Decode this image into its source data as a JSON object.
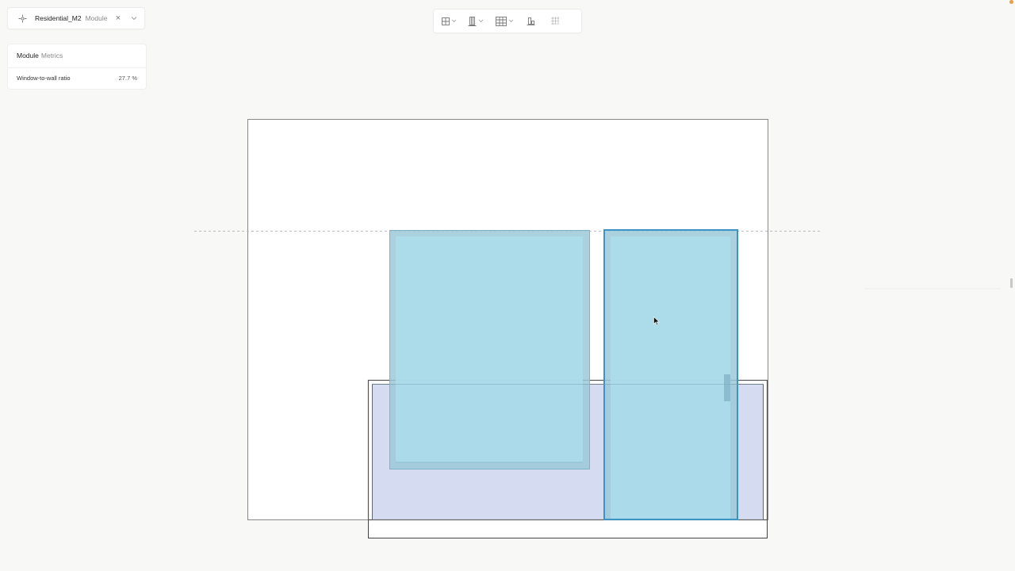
{
  "module_selector": {
    "name": "Residential_M2",
    "type": "Module",
    "icons": {
      "grip": "move-icon",
      "close": "close-icon",
      "expand": "chevron-down-icon"
    }
  },
  "metrics": {
    "title": "Module",
    "subtitle": "Metrics",
    "rows": [
      {
        "label": "Window-to-wall ratio",
        "value": "27.7 %"
      }
    ]
  },
  "toolbar": {
    "tools": [
      {
        "icon": "grid-window-icon",
        "dropdown": true
      },
      {
        "icon": "door-icon",
        "dropdown": true
      },
      {
        "icon": "facade-grid-icon",
        "dropdown": true
      },
      {
        "icon": "align-left-icon",
        "dropdown": false
      },
      {
        "icon": "dot-grid-icon",
        "dropdown": false
      }
    ]
  },
  "colors": {
    "window_fill": "#a9d6e6",
    "window_border": "#7fb3c7",
    "selected_border": "#3a94c4",
    "balcony_fill": "#d5dcf2",
    "wall_outline": "#8a8a8a",
    "accent_dot": "#e8a040"
  }
}
